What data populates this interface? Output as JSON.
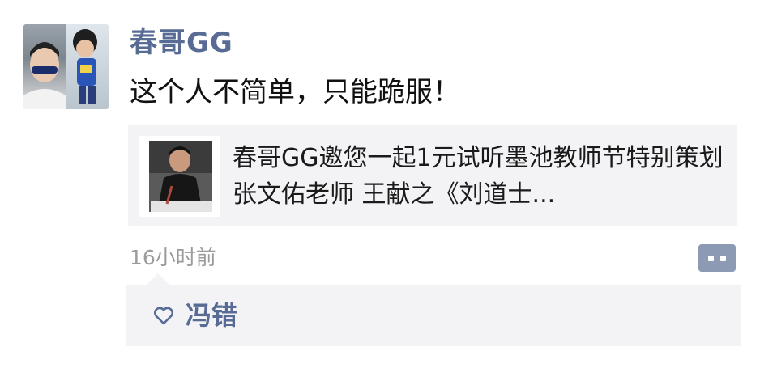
{
  "post": {
    "author": "春哥GG",
    "text": "这个人不简单，只能跪服！",
    "link_card": {
      "title": "春哥GG邀您一起1元试听墨池教师节特别策划 张文佑老师 王献之《刘道士..."
    },
    "timestamp": "16小时前",
    "likes": {
      "icon": "heart-outline-icon",
      "names": "冯错"
    }
  },
  "colors": {
    "nickname": "#576b95",
    "comment_button": "#8d9ab3",
    "card_background": "#f3f3f5",
    "timestamp": "#9b9b9b"
  }
}
